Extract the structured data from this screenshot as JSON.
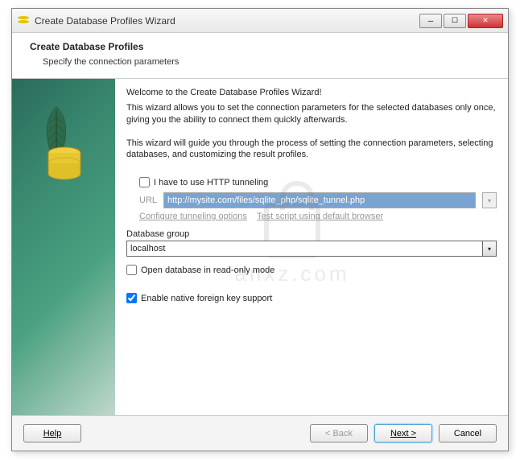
{
  "window": {
    "title": "Create Database Profiles Wizard"
  },
  "header": {
    "title": "Create Database Profiles",
    "subtitle": "Specify the connection parameters"
  },
  "intro": {
    "line1": "Welcome to the Create Database Profiles Wizard!",
    "line2": "This wizard allows you to set the connection parameters for the selected databases only once, giving you the ability to connect them quickly afterwards.",
    "line3": "This wizard will guide you through the process of setting the connection parameters, selecting databases, and customizing the result profiles."
  },
  "http_tunnel": {
    "checkbox_label": "I have to use HTTP tunneling",
    "checked": false,
    "url_label": "URL",
    "url_value": "http://mysite.com/files/sqlite_php/sqlite_tunnel.php",
    "configure_link": "Configure tunneling options",
    "test_link": "Test script using default browser"
  },
  "database_group": {
    "label": "Database group",
    "value": "localhost"
  },
  "readonly": {
    "label": "Open database in read-only mode",
    "checked": false
  },
  "foreign_key": {
    "label": "Enable native foreign key support",
    "checked": true
  },
  "footer": {
    "help": "Help",
    "back": "< Back",
    "next": "Next >",
    "cancel": "Cancel"
  },
  "watermark": "anxz.com"
}
